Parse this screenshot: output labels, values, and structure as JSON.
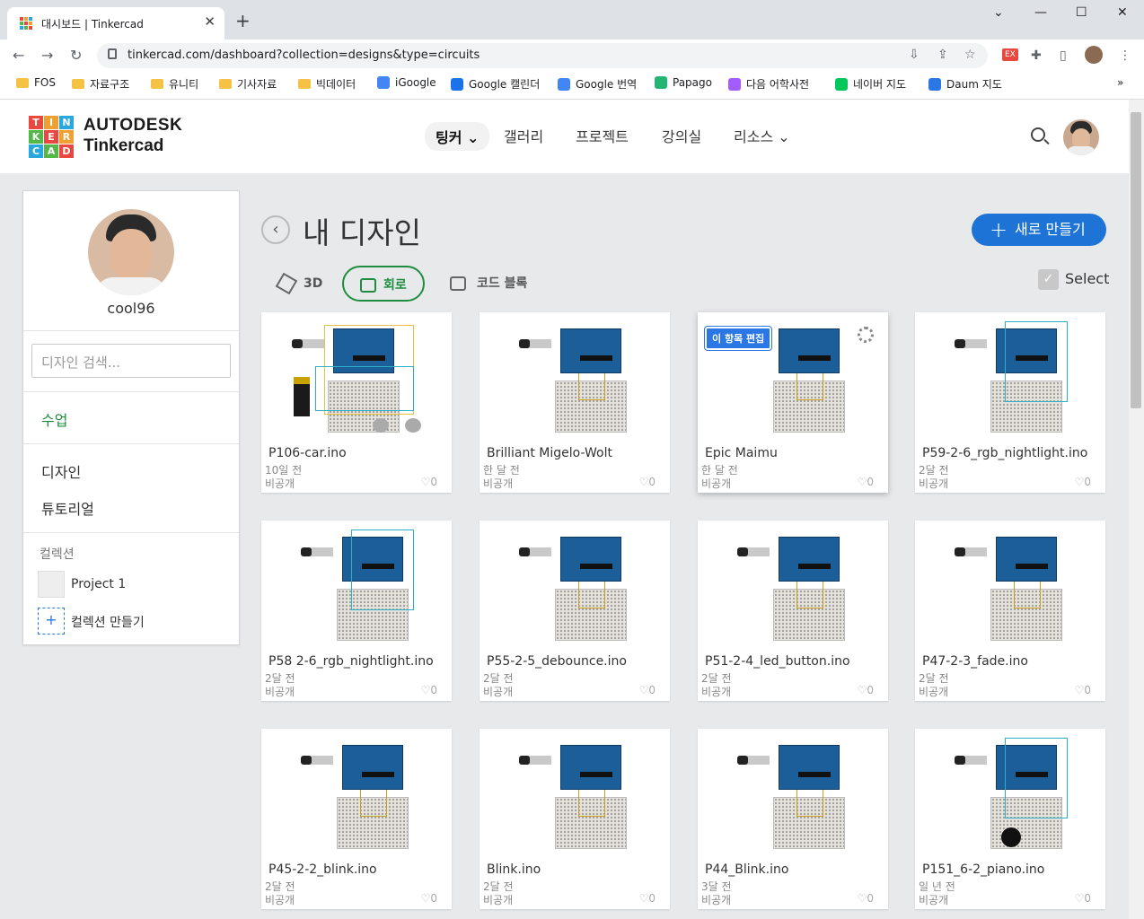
{
  "browser": {
    "tab_title": "대시보드 | Tinkercad",
    "url": "tinkercad.com/dashboard?collection=designs&type=circuits",
    "bookmarks": [
      {
        "label": "FOS",
        "icon": "folder-icon"
      },
      {
        "label": "자료구조",
        "icon": "folder-icon"
      },
      {
        "label": "유니티",
        "icon": "folder-icon"
      },
      {
        "label": "기사자료",
        "icon": "folder-icon"
      },
      {
        "label": "빅데이터",
        "icon": "folder-icon"
      },
      {
        "label": "iGoogle",
        "icon": "google-icon"
      },
      {
        "label": "Google 캘린더",
        "icon": "calendar-icon"
      },
      {
        "label": "Google 번역",
        "icon": "translate-icon"
      },
      {
        "label": "Papago",
        "icon": "papago-icon"
      },
      {
        "label": "다음 어학사전",
        "icon": "daum-dict-icon"
      },
      {
        "label": "네이버 지도",
        "icon": "naver-map-icon"
      },
      {
        "label": "Daum 지도",
        "icon": "daum-map-icon"
      }
    ]
  },
  "header": {
    "brand_line1": "AUTODESK",
    "brand_line2": "Tinkercad",
    "logo_letters": [
      "T",
      "I",
      "N",
      "K",
      "E",
      "R",
      "C",
      "A",
      "D"
    ],
    "nav": [
      "팅커",
      "갤러리",
      "프로젝트",
      "강의실",
      "리소스"
    ]
  },
  "sidebar": {
    "username": "cool96",
    "search_placeholder": "디자인 검색...",
    "classes_label": "수업",
    "designs_label": "디자인",
    "tutorials_label": "튜토리얼",
    "collections_heading": "컬렉션",
    "collection_name": "Project 1",
    "new_collection_label": "컬렉션 만들기"
  },
  "main": {
    "title": "내 디자인",
    "new_button": "새로 만들기",
    "filters": [
      "3D",
      "회로",
      "코드 블록"
    ],
    "select_label": "Select",
    "edit_badge": "이 항목 편집",
    "designs": [
      {
        "name": "P106-car.ino",
        "age": "10일 전",
        "visibility": "비공개",
        "likes": "0"
      },
      {
        "name": "Brilliant Migelo-Wolt",
        "age": "한 달 전",
        "visibility": "비공개",
        "likes": "0"
      },
      {
        "name": "Epic Maimu",
        "age": "한 달 전",
        "visibility": "비공개",
        "likes": "0"
      },
      {
        "name": "P59-2-6_rgb_nightlight.ino",
        "age": "2달 전",
        "visibility": "비공개",
        "likes": "0"
      },
      {
        "name": "P58 2-6_rgb_nightlight.ino",
        "age": "2달 전",
        "visibility": "비공개",
        "likes": "0"
      },
      {
        "name": "P55-2-5_debounce.ino",
        "age": "2달 전",
        "visibility": "비공개",
        "likes": "0"
      },
      {
        "name": "P51-2-4_led_button.ino",
        "age": "2달 전",
        "visibility": "비공개",
        "likes": "0"
      },
      {
        "name": "P47-2-3_fade.ino",
        "age": "2달 전",
        "visibility": "비공개",
        "likes": "0"
      },
      {
        "name": "P45-2-2_blink.ino",
        "age": "2달 전",
        "visibility": "비공개",
        "likes": "0"
      },
      {
        "name": "Blink.ino",
        "age": "2달 전",
        "visibility": "비공개",
        "likes": "0"
      },
      {
        "name": "P44_Blink.ino",
        "age": "3달 전",
        "visibility": "비공개",
        "likes": "0"
      },
      {
        "name": "P151_6-2_piano.ino",
        "age": "일 년 전",
        "visibility": "비공개",
        "likes": "0"
      }
    ]
  },
  "colors": {
    "accent_blue": "#1e74d6",
    "accent_green": "#1e8e3e",
    "logo_red": "#e8483f",
    "logo_orange": "#f0a030",
    "logo_blue": "#29a8e0",
    "logo_green": "#54b848"
  }
}
